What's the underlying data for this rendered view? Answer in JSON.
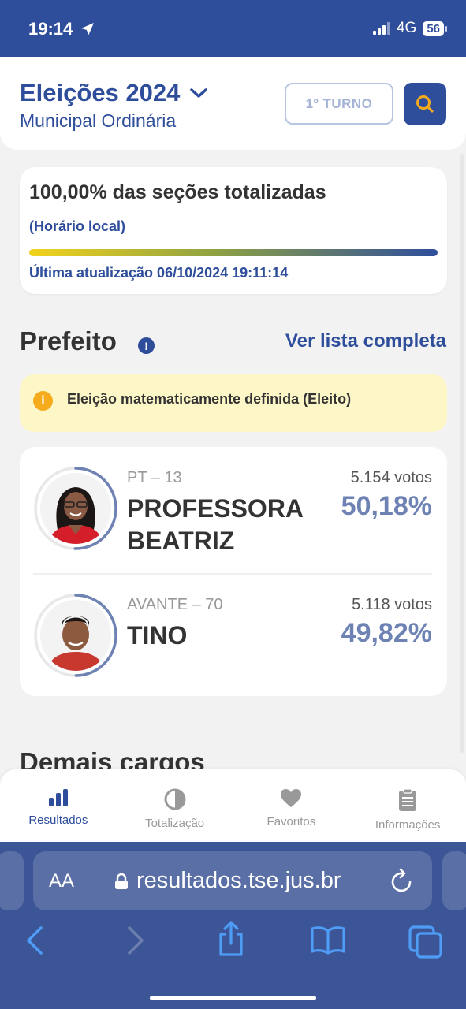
{
  "status": {
    "time": "19:14",
    "network": "4G",
    "battery": "56"
  },
  "header": {
    "title": "Eleições 2024",
    "subtitle": "Municipal Ordinária",
    "turno": "1º TURNO"
  },
  "progress": {
    "title": "100,00% das seções totalizadas",
    "local": "(Horário local)",
    "fraction": 1.0,
    "last_update": "Última atualização 06/10/2024 19:11:14"
  },
  "section": {
    "title": "Prefeito",
    "info_icon": "!",
    "link": "Ver lista completa"
  },
  "alert": {
    "icon": "i",
    "text": "Eleição matematicamente definida (Eleito)"
  },
  "candidates": [
    {
      "party": "PT – 13",
      "name": "PROFESSORA BEATRIZ",
      "votes": "5.154 votos",
      "percent": "50,18%",
      "share": 0.5018
    },
    {
      "party": "AVANTE – 70",
      "name": "TINO",
      "votes": "5.118 votos",
      "percent": "49,82%",
      "share": 0.4982
    }
  ],
  "next_section": "Demais cargos",
  "tabs": [
    {
      "label": "Resultados",
      "icon": "bar-chart-icon",
      "active": true
    },
    {
      "label": "Totalização",
      "icon": "pie-icon",
      "active": false
    },
    {
      "label": "Favoritos",
      "icon": "heart-icon",
      "active": false
    },
    {
      "label": "Informações",
      "icon": "clipboard-icon",
      "active": false
    }
  ],
  "browser": {
    "aa": "AA",
    "url": "resultados.tse.jus.br"
  },
  "colors": {
    "brand": "#2e4e9c",
    "accent": "#f5ab1b",
    "alert_bg": "#fdf7c8"
  }
}
